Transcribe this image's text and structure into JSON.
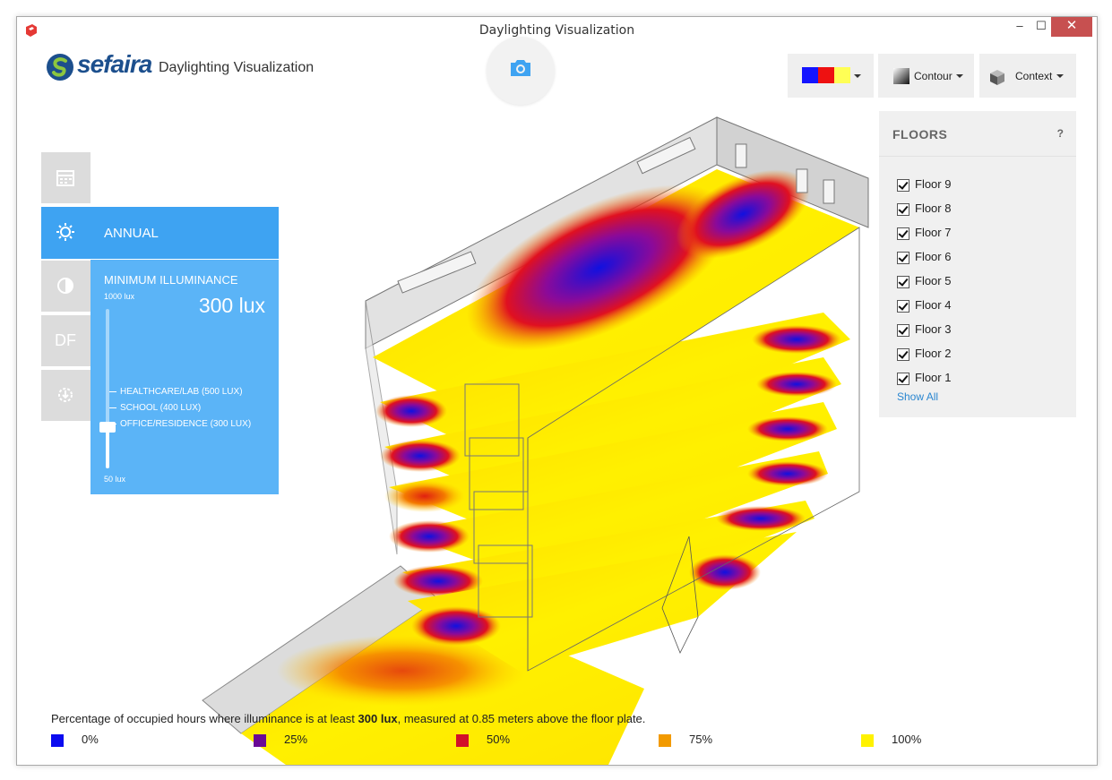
{
  "window": {
    "title": "Daylighting Visualization",
    "min_glyph": "–",
    "max_glyph": "☐",
    "close_glyph": "✕"
  },
  "brand": {
    "name": "sefaira",
    "subtitle": "Daylighting Visualization"
  },
  "toolbar": {
    "palette_colors": [
      "#1414ff",
      "#ee1111",
      "#ffff55"
    ],
    "contour_label": "Contour",
    "context_label": "Context"
  },
  "sidebar": {
    "active_tab_label": "ANNUAL",
    "df_label": "DF"
  },
  "illuminance": {
    "title": "MINIMUM ILLUMINANCE",
    "max_label": "1000 lux",
    "min_label": "50 lux",
    "value": "300 lux",
    "slider_fraction": 0.26,
    "marks": [
      "HEALTHCARE/LAB (500 LUX)",
      "SCHOOL (400 LUX)",
      "OFFICE/RESIDENCE (300 LUX)"
    ]
  },
  "floors": {
    "title": "FLOORS",
    "help": "?",
    "items": [
      {
        "label": "Floor 9",
        "checked": true
      },
      {
        "label": "Floor 8",
        "checked": true
      },
      {
        "label": "Floor 7",
        "checked": true
      },
      {
        "label": "Floor 6",
        "checked": true
      },
      {
        "label": "Floor 5",
        "checked": true
      },
      {
        "label": "Floor 4",
        "checked": true
      },
      {
        "label": "Floor 3",
        "checked": true
      },
      {
        "label": "Floor 2",
        "checked": true
      },
      {
        "label": "Floor 1",
        "checked": true
      }
    ],
    "show_all": "Show All"
  },
  "legend": {
    "text_before": "Percentage of occupied hours where illuminance is at least ",
    "text_bold": "300 lux",
    "text_after": ", measured at 0.85 meters above the floor plate.",
    "items": [
      {
        "label": "0%",
        "color": "#0b0bf0"
      },
      {
        "label": "25%",
        "color": "#6a0a96"
      },
      {
        "label": "50%",
        "color": "#d2102a"
      },
      {
        "label": "75%",
        "color": "#f29a00"
      },
      {
        "label": "100%",
        "color": "#fff200"
      }
    ]
  }
}
